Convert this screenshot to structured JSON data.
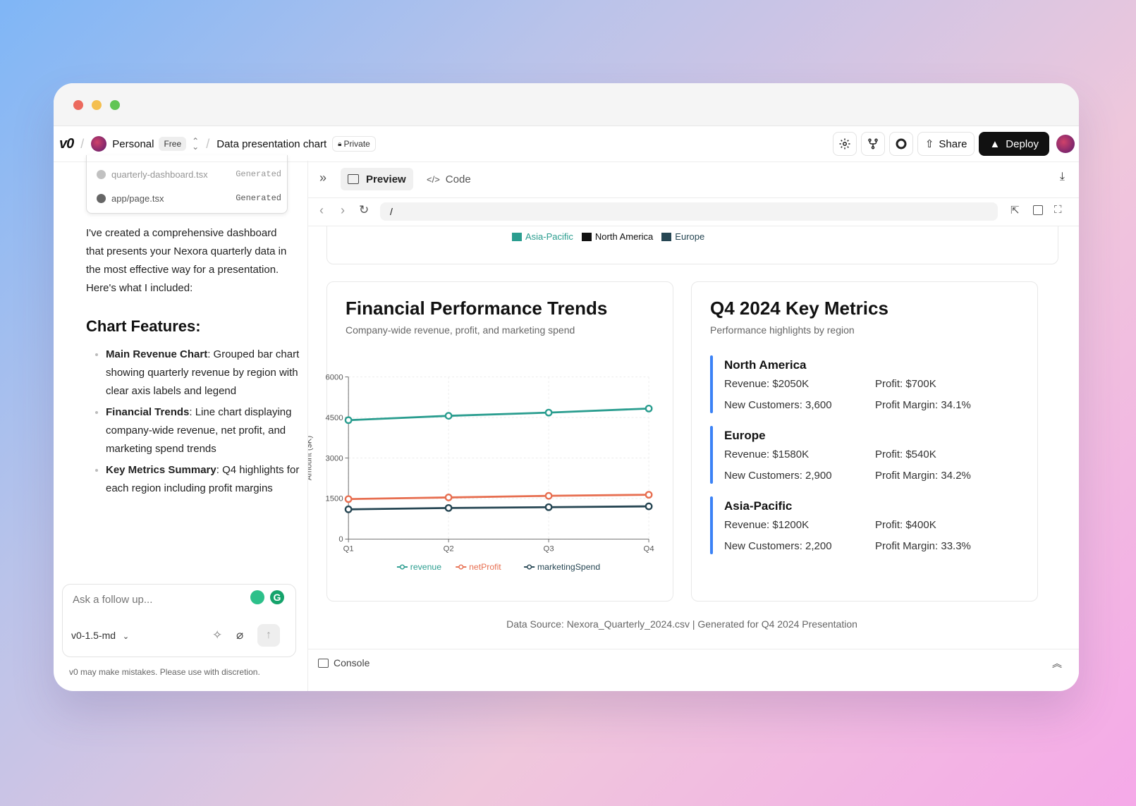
{
  "topbar": {
    "logo": "v0",
    "workspace": "Personal",
    "plan_badge": "Free",
    "project": "Data presentation chart",
    "visibility": "Private",
    "share_label": "Share",
    "deploy_label": "Deploy"
  },
  "chat": {
    "files": [
      {
        "name": "quarterly-dashboard.tsx",
        "status": "Generated"
      },
      {
        "name": "app/page.tsx",
        "status": "Generated"
      }
    ],
    "intro": "I've created a comprehensive dashboard that presents your Nexora quarterly data in the most effective way for a presentation. Here's what I included:",
    "heading": "Chart Features:",
    "bullets": [
      {
        "bold": "Main Revenue Chart",
        "text": ": Grouped bar chart showing quarterly revenue by region with clear axis labels and legend"
      },
      {
        "bold": "Financial Trends",
        "text": ": Line chart displaying company-wide revenue, net profit, and marketing spend trends"
      },
      {
        "bold": "Key Metrics Summary",
        "text": ": Q4 highlights for each region including profit margins"
      }
    ],
    "input_placeholder": "Ask a follow up...",
    "model": "v0-1.5-md",
    "disclaimer": "v0 may make mistakes. Please use with discretion."
  },
  "preview": {
    "tab_preview": "Preview",
    "tab_code": "Code",
    "url": "/",
    "top_legend": [
      "Asia-Pacific",
      "North America",
      "Europe"
    ],
    "top_legend_colors": [
      "#2a9d8f",
      "#111111",
      "#264653"
    ],
    "trends": {
      "title": "Financial Performance Trends",
      "subtitle": "Company-wide revenue, profit, and marketing spend"
    },
    "metrics": {
      "title": "Q4 2024 Key Metrics",
      "subtitle": "Performance highlights by region",
      "regions": [
        {
          "name": "North America",
          "revenue": "Revenue: $2050K",
          "profit": "Profit: $700K",
          "customers": "New Customers: 3,600",
          "margin": "Profit Margin: 34.1%"
        },
        {
          "name": "Europe",
          "revenue": "Revenue: $1580K",
          "profit": "Profit: $540K",
          "customers": "New Customers: 2,900",
          "margin": "Profit Margin: 34.2%"
        },
        {
          "name": "Asia-Pacific",
          "revenue": "Revenue: $1200K",
          "profit": "Profit: $400K",
          "customers": "New Customers: 2,200",
          "margin": "Profit Margin: 33.3%"
        }
      ]
    },
    "footer": "Data Source: Nexora_Quarterly_2024.csv | Generated for Q4 2024 Presentation",
    "console_label": "Console"
  },
  "chart_data": {
    "type": "line",
    "x": [
      "Q1",
      "Q2",
      "Q3",
      "Q4"
    ],
    "ylabel": "Amount ($K)",
    "ylim": [
      0,
      6000
    ],
    "yticks": [
      0,
      1500,
      3000,
      4500,
      6000
    ],
    "grid": true,
    "legend": "bottom",
    "series": [
      {
        "name": "revenue",
        "values": [
          4400,
          4560,
          4680,
          4830
        ],
        "color": "#2a9d8f"
      },
      {
        "name": "netProfit",
        "values": [
          1480,
          1540,
          1600,
          1640
        ],
        "color": "#e76f51"
      },
      {
        "name": "marketingSpend",
        "values": [
          1100,
          1150,
          1180,
          1210
        ],
        "color": "#264653"
      }
    ]
  }
}
